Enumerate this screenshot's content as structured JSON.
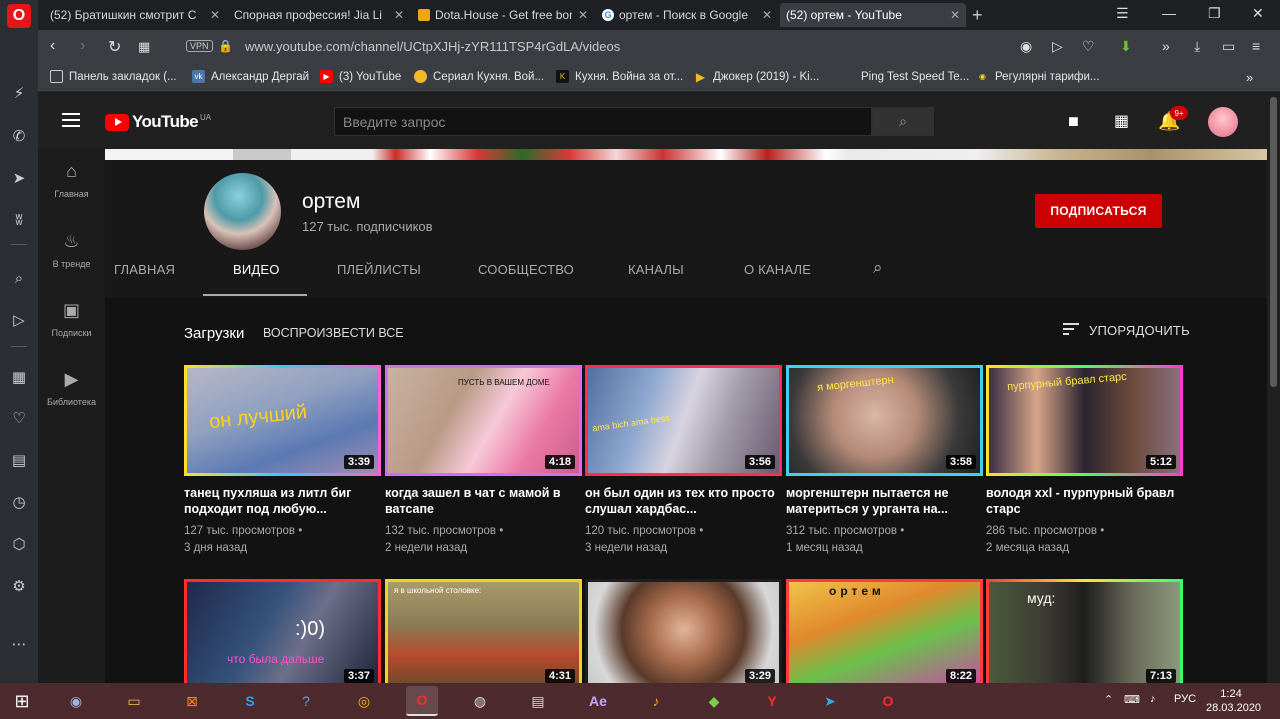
{
  "browser": {
    "tabs": [
      {
        "title": "(52) Братишкин смотрит С",
        "icon": "youtube-icon"
      },
      {
        "title": "Спорная профессия! Jia Li",
        "icon": "youtube-icon"
      },
      {
        "title": "Dota.House - Get free bonu",
        "icon": "dota-house-icon"
      },
      {
        "title": "ортем - Поиск в Google",
        "icon": "google-icon"
      },
      {
        "title": "(52) ортем - YouTube",
        "icon": "youtube-icon"
      }
    ],
    "vpn_label": "VPN",
    "url": "www.youtube.com/channel/UCtpXJHj-zYR111TSP4rGdLA/videos",
    "bookmarks": [
      "Панель закладок (...",
      "Александр Дергай",
      "(3) YouTube",
      "Сериал Кухня. Вой...",
      "Кухня. Война за от...",
      "Джокер (2019) - Ki...",
      "Ping Test Speed Te...",
      "Регулярні тарифи..."
    ]
  },
  "youtube": {
    "logo_text": "YouTube",
    "logo_region": "UA",
    "search_placeholder": "Введите запрос",
    "notifications_count": "9+",
    "guide": [
      {
        "label": "Главная",
        "icon": "home-icon"
      },
      {
        "label": "В тренде",
        "icon": "fire-icon"
      },
      {
        "label": "Подписки",
        "icon": "subscriptions-icon"
      },
      {
        "label": "Библиотека",
        "icon": "library-icon"
      }
    ],
    "channel": {
      "name": "ортем",
      "subscribers": "127 тыс. подписчиков",
      "subscribe_label": "ПОДПИСАТЬСЯ",
      "tabs": [
        "ГЛАВНАЯ",
        "ВИДЕО",
        "ПЛЕЙЛИСТЫ",
        "СООБЩЕСТВО",
        "КАНАЛЫ",
        "О КАНАЛЕ"
      ],
      "active_tab": "ВИДЕО"
    },
    "section": {
      "title": "Загрузки",
      "play_all": "ВОСПРОИЗВЕСТИ ВСЕ",
      "sort": "УПОРЯДОЧИТЬ"
    },
    "videos": [
      {
        "title": "танец пухляша из литл биг подходит под любую...",
        "views": "127 тыс. просмотров",
        "age": "3 дня назад",
        "duration": "3:39",
        "overlay": "он лучший"
      },
      {
        "title": "когда зашел в чат с мамой в ватсапе",
        "views": "132 тыс. просмотров",
        "age": "2 недели назад",
        "duration": "4:18",
        "overlay": "ПУСТЬ В ВАШЕМ ДОМЕ"
      },
      {
        "title": "он был один из тех кто просто слушал хардбас...",
        "views": "120 тыс. просмотров",
        "age": "3 недели назад",
        "duration": "3:56",
        "overlay": "ama bich ama bess"
      },
      {
        "title": "моргенштерн пытается не материться у урганта на...",
        "views": "312 тыс. просмотров",
        "age": "1 месяц назад",
        "duration": "3:58",
        "overlay": "я моргенштерн"
      },
      {
        "title": "володя xxl - пурпурный бравл старс",
        "views": "286 тыс. просмотров",
        "age": "2 месяца назад",
        "duration": "5:12",
        "overlay": "пурпурный бравл старс"
      },
      {
        "title": "",
        "views": "",
        "age": "",
        "duration": "3:37",
        "overlay": "что была дальше"
      },
      {
        "title": "",
        "views": "",
        "age": "",
        "duration": "4:31",
        "overlay": "я в школьной столовке:"
      },
      {
        "title": "",
        "views": "",
        "age": "",
        "duration": "3:29",
        "overlay": ""
      },
      {
        "title": "",
        "views": "",
        "age": "",
        "duration": "8:22",
        "overlay": "ортем"
      },
      {
        "title": "",
        "views": "",
        "age": "",
        "duration": "7:13",
        "overlay": "муд:"
      }
    ]
  },
  "taskbar": {
    "lang": "РУС",
    "time": "1:24",
    "date": "28.03.2020"
  }
}
